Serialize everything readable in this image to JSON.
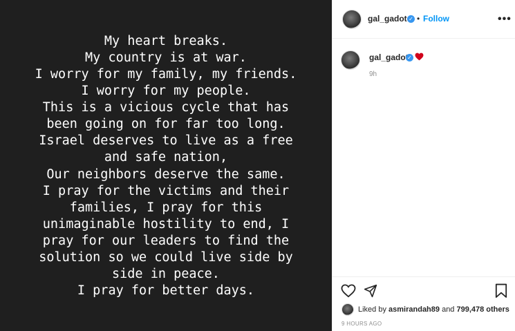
{
  "post": {
    "lines": [
      "My heart breaks.",
      "My country is at war.",
      "I worry for my family, my friends.",
      "I worry for my people.",
      "This is a vicious cycle that has",
      "been going on for far too long.",
      "Israel deserves to live as a free",
      "and safe nation,",
      "Our neighbors deserve the same.",
      "I pray for the victims and their",
      "families, I pray for this",
      "unimaginable hostility to end, I",
      "pray for our leaders to find the",
      "solution so we could live side by",
      "side in peace.",
      "I pray for better days."
    ],
    "background_color": "#1f1f1f",
    "text_color": "#ffffff"
  },
  "header": {
    "username": "gal_gadot",
    "separator": "•",
    "follow_label": "Follow",
    "more_label": "•••"
  },
  "caption": {
    "username": "gal_gadot",
    "emoji": "red-heart",
    "time": "9h"
  },
  "footer": {
    "liked_prefix": "Liked by ",
    "liked_user": "asmirandah89",
    "liked_middle": " and ",
    "liked_count": "799,478 others",
    "timestamp": "9 HOURS AGO"
  },
  "colors": {
    "accent": "#0095f6",
    "verified": "#3897f0",
    "heart": "#d0021b",
    "muted": "#8e8e8e"
  },
  "icons": [
    "verified-badge-icon",
    "red-heart-icon",
    "like-icon",
    "share-icon",
    "save-icon",
    "more-icon"
  ]
}
